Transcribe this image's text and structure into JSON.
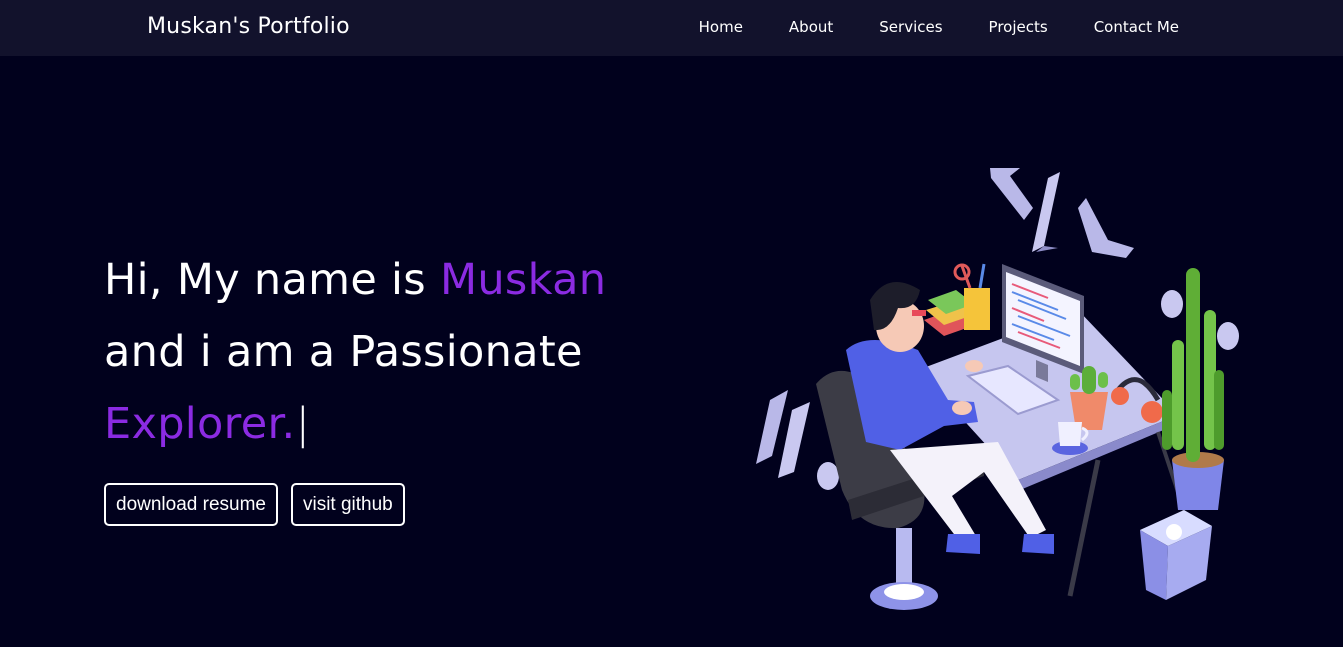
{
  "navbar": {
    "brand": "Muskan's Portfolio",
    "links": [
      "Home",
      "About",
      "Services",
      "Projects",
      "Contact Me"
    ]
  },
  "hero": {
    "line1_pre": "Hi, My name is ",
    "line1_accent": "Muskan",
    "line2": "and i am a Passionate",
    "line3_accent": "Explorer.",
    "cursor": "|"
  },
  "buttons": {
    "resume": "download resume",
    "github": "visit github"
  },
  "colors": {
    "background": "#01011d",
    "navbar": "#12122c",
    "accent": "#8b2be2",
    "text": "#ffffff"
  },
  "illustration": {
    "icon": "developer-at-desk-illustration"
  }
}
